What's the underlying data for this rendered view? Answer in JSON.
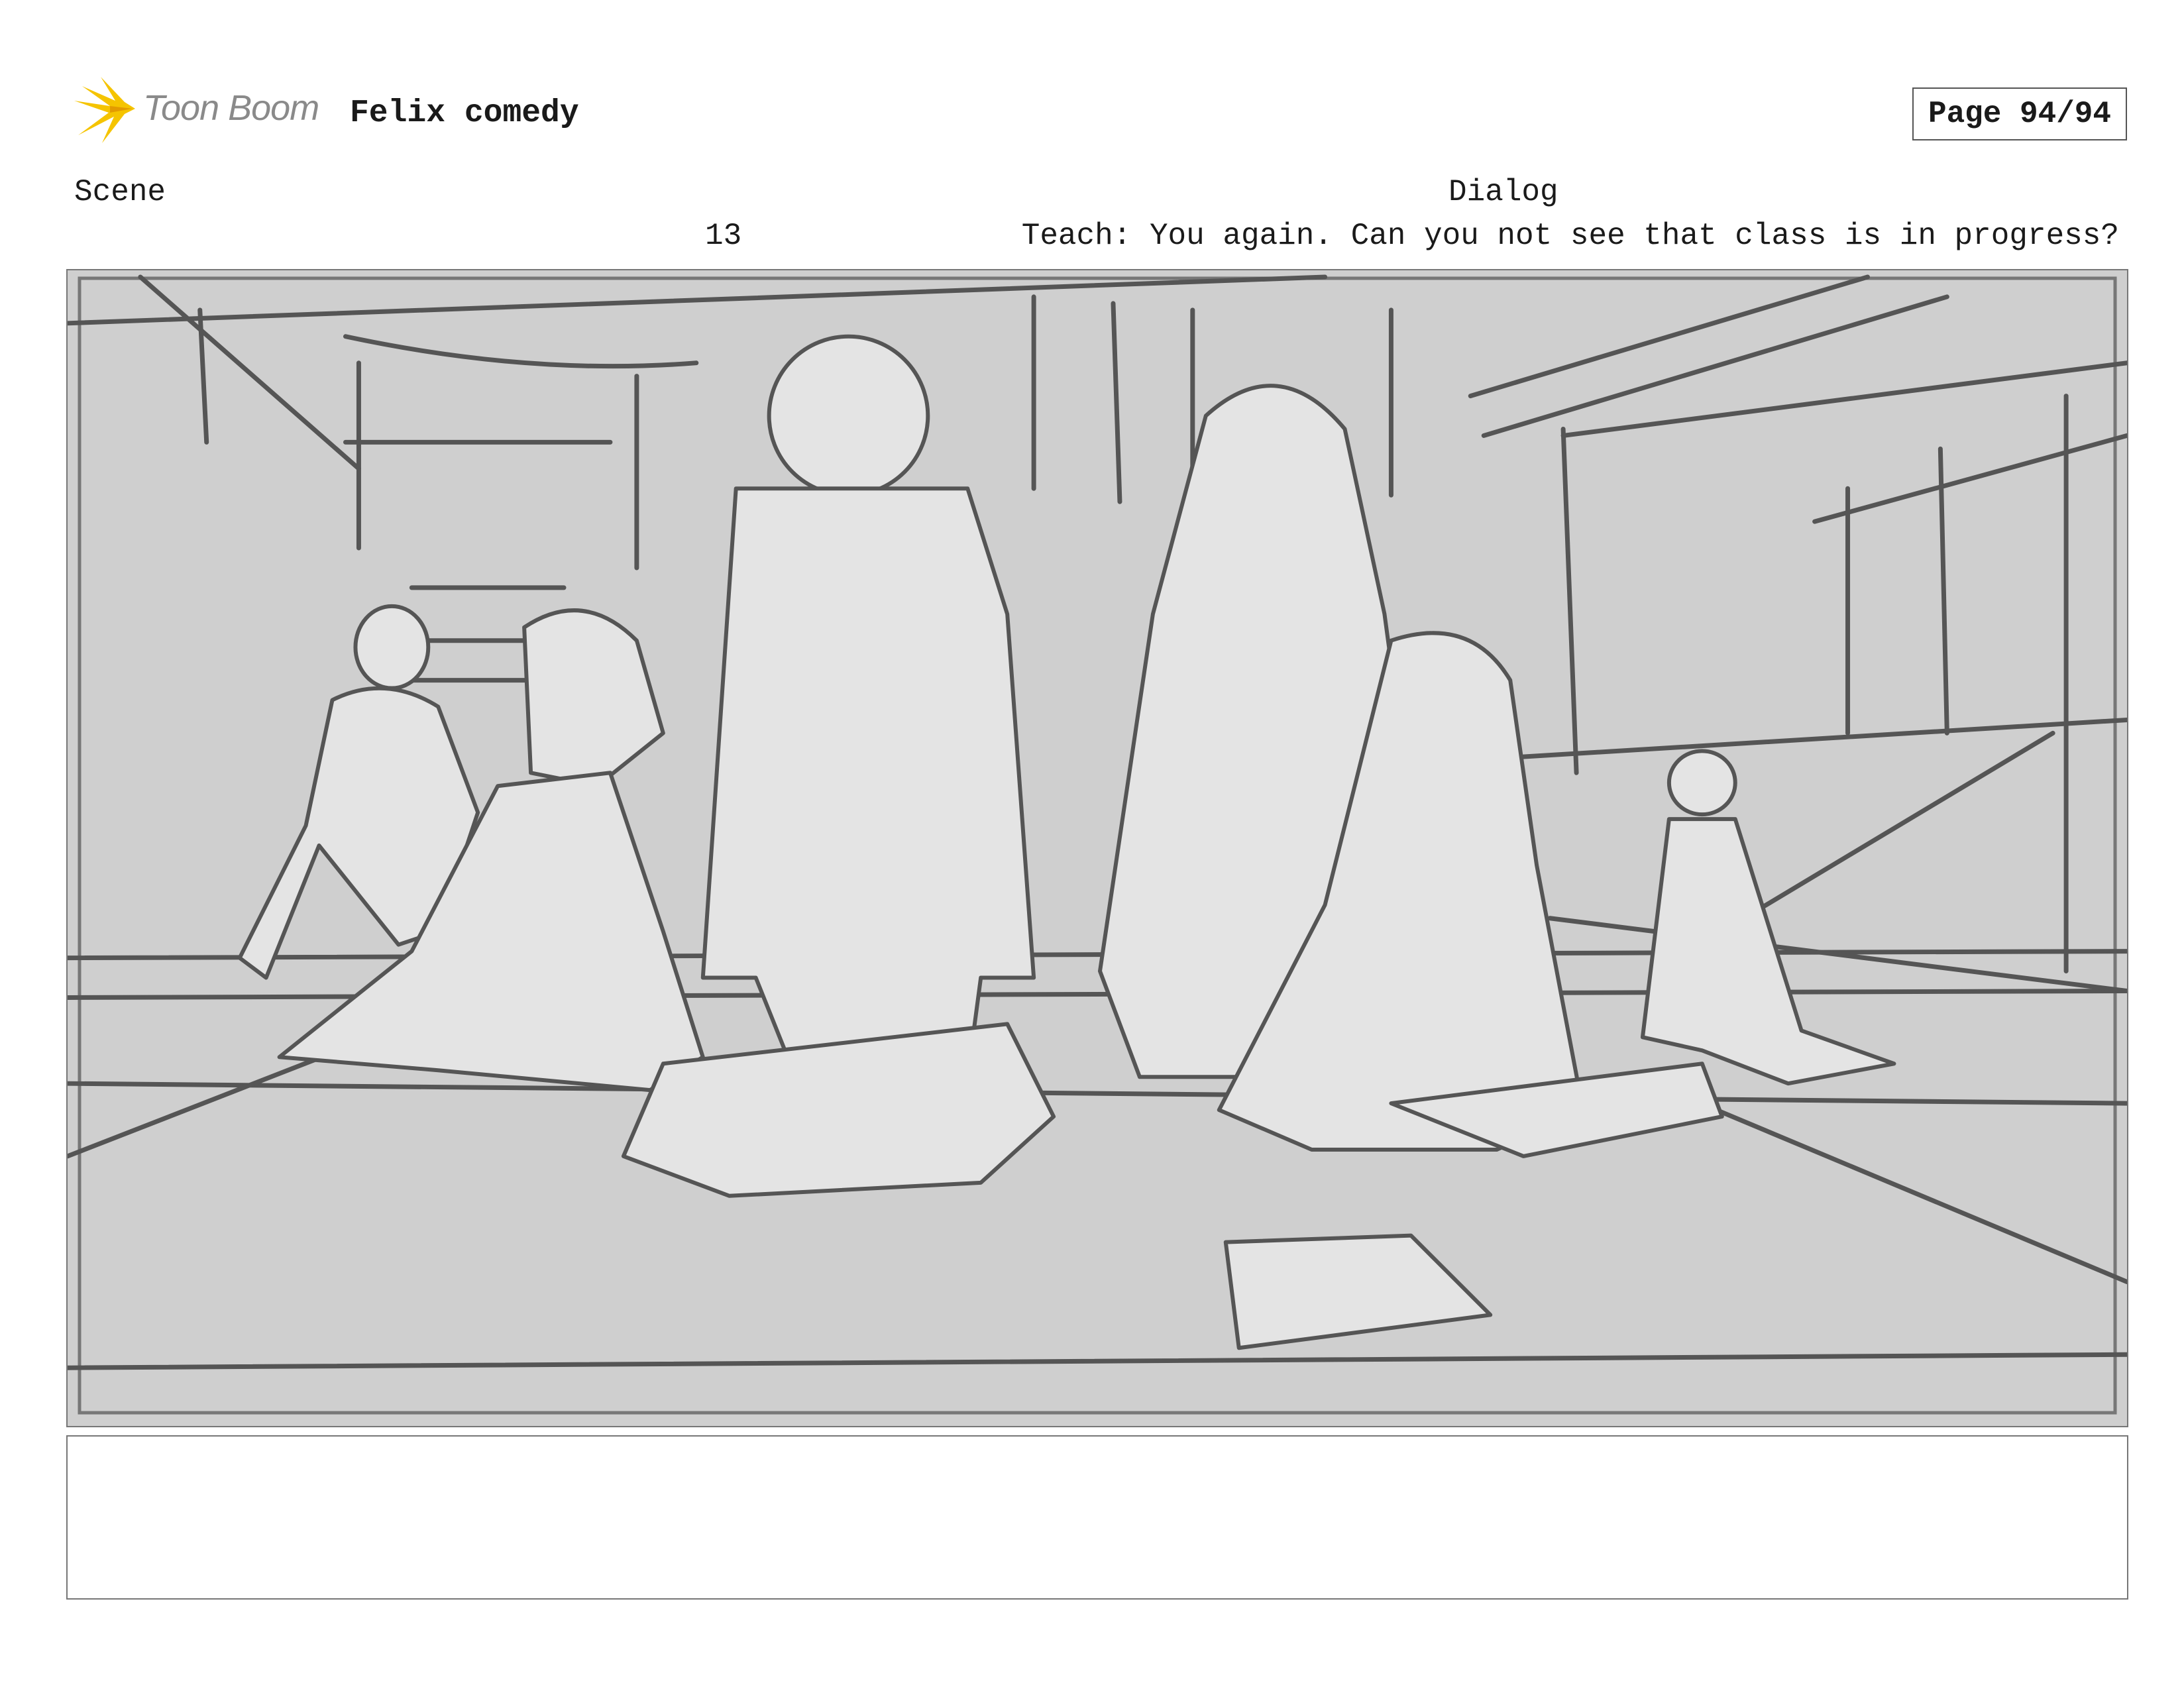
{
  "header": {
    "logo_text": "Toon Boom",
    "project_title": "Felix comedy",
    "page": "Page 94/94"
  },
  "columns": {
    "scene_label": "Scene",
    "dialog_label": "Dialog"
  },
  "panel": {
    "scene_number": "13",
    "dialog": "Teach: You again. Can you not see that class is in progress?",
    "image": "storyboard-sketch"
  },
  "notes": {
    "text": ""
  },
  "colors": {
    "logo_burst": "#f5c400",
    "logo_text": "#8a8a8a",
    "sketch_bg": "#cfcfcf",
    "sketch_line": "#555555",
    "figure_fill": "#e4e4e4"
  }
}
